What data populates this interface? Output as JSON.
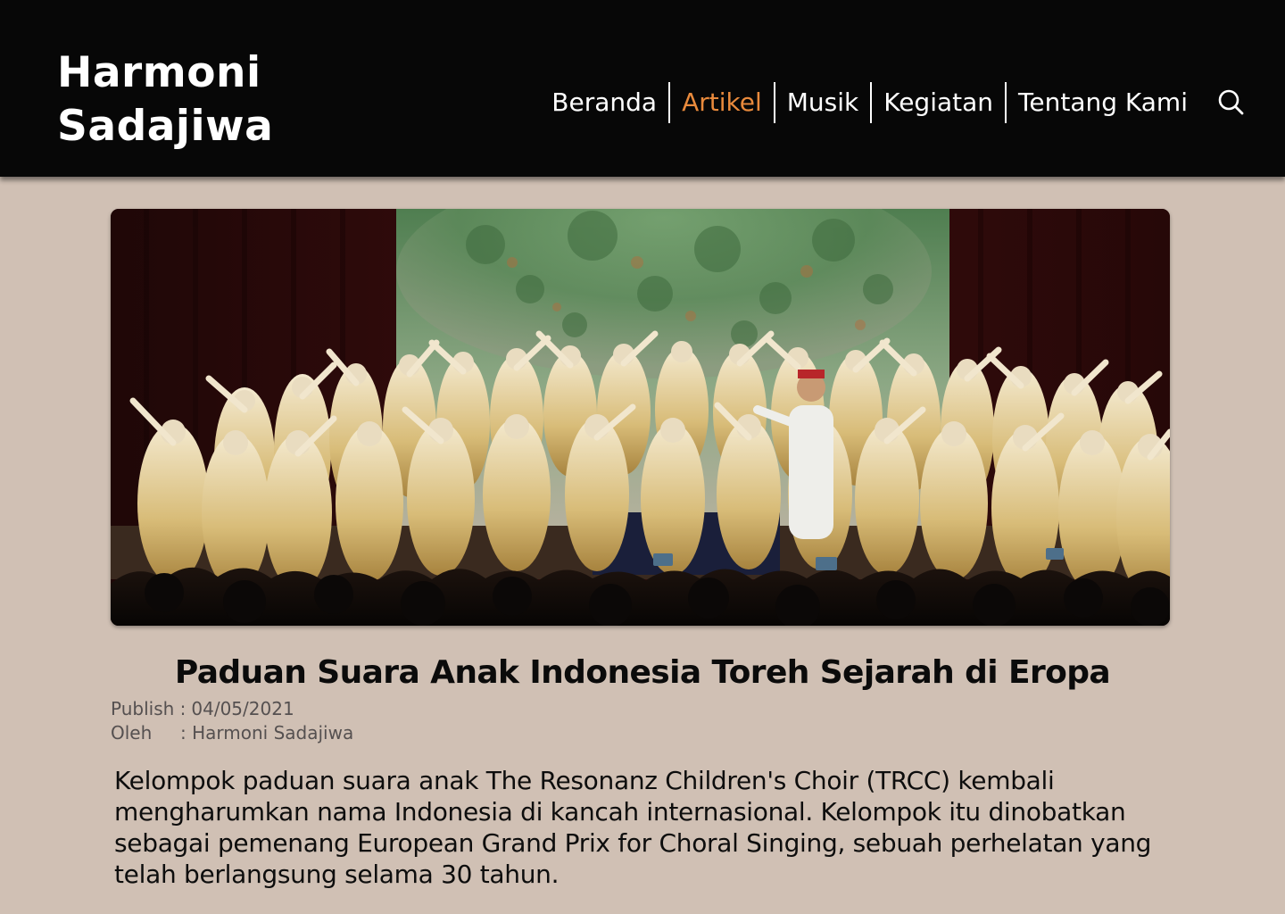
{
  "header": {
    "logo_line1": "Harmoni",
    "logo_line2": "Sadajiwa",
    "nav": [
      {
        "label": "Beranda",
        "active": false
      },
      {
        "label": "Artikel",
        "active": true
      },
      {
        "label": "Musik",
        "active": false
      },
      {
        "label": "Kegiatan",
        "active": false
      },
      {
        "label": "Tentang Kami",
        "active": false
      }
    ],
    "search_icon": "search-icon",
    "accent_color": "#e98a3c",
    "background_color": "#070707"
  },
  "article": {
    "image": "choir-performance-photo",
    "title": "Paduan Suara Anak Indonesia Toreh Sejarah di Eropa",
    "publish_label": "Publish :",
    "publish_date": "04/05/2021",
    "author_label": "Oleh",
    "author": ": Harmoni Sadajiwa",
    "body": "Kelompok paduan suara anak The Resonanz Children's Choir (TRCC) kembali mengharumkan nama Indonesia di kancah internasional. Kelompok itu dinobatkan sebagai pemenang European Grand Prix for Choral Singing, sebuah perhelatan yang telah berlangsung selama 30 tahun."
  },
  "page_background": "#d0c0b4"
}
